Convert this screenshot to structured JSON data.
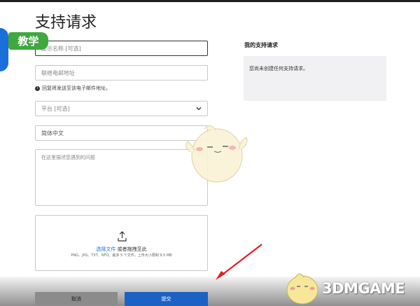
{
  "badge": "教学",
  "page_title": "支持请求",
  "form": {
    "name_placeholder": "显示名称 [可选]",
    "email_placeholder": "联络电邮地址",
    "email_hint": "回复将发送至该电子邮件地址。",
    "platform_placeholder": "平台 [可选]",
    "language_value": "简体中文",
    "description_placeholder": "在这里描述您遇到的问题",
    "upload": {
      "link_text": "选择文件",
      "rest_text": " 或者拖拽至此",
      "types_text": "PNG、JPG、TXT、NFO。最多 5 个文件，上传大小限制 9.5 MB"
    }
  },
  "sidebar": {
    "title": "我的支持请求",
    "empty_text": "您尚未创建任何支持请求。"
  },
  "buttons": {
    "cancel": "取消",
    "submit": "提交"
  },
  "watermark": "3DMGAME",
  "colors": {
    "badge_green": "#3fa83e",
    "submit_blue": "#1c62c5",
    "arrow_red": "#e02020"
  }
}
